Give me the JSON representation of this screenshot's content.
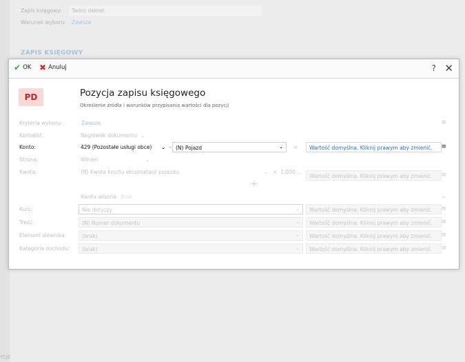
{
  "background": {
    "rows": [
      {
        "label": "Zapis księgowy:",
        "value": "Twórz dekret"
      },
      {
        "label": "Warunek wyboru:",
        "value": "Zawsze"
      }
    ],
    "section_title": "ZAPIS KSIĘGOWY",
    "bottom_text": "YCJE"
  },
  "dialog": {
    "toolbar": {
      "ok_label": "OK",
      "cancel_label": "Anuluj",
      "help_label": "?",
      "close_label": "✕"
    },
    "badge": "PD",
    "title": "Pozycja zapisu księgowego",
    "subtitle": "Określenie źródła i warunków przypisania wartości dla pozycji",
    "form": {
      "kryteria": {
        "label": "Kryteria wyboru:",
        "value": "Zawsze"
      },
      "kontekst": {
        "label": "Kontekst:",
        "value": "Nagłówek dokumentu"
      },
      "konto": {
        "label": "Konto:",
        "value": "429 (Pozostałe usługi obce)",
        "separator": "-",
        "value2": "(N) Pojazd",
        "default": "Wartość domyślna. Kliknij prawym aby zmienić."
      },
      "strona": {
        "label": "Strona:",
        "value": "Winien"
      },
      "kwota": {
        "label": "Kwota:",
        "value": "(N) Kwota kosztu eksploatacji pojazdu",
        "multiplier": "x",
        "factor": "1,000 ...",
        "default": "Wartość domyślna. Kliknij prawym aby zmienić."
      },
      "kwota_wlasna": {
        "label": "Kwota własna:",
        "value": "Brak"
      },
      "kurs": {
        "label": "Kurs:",
        "value": "Nie dotyczy",
        "default": "Wartość domyślna. Kliknij prawym aby zmienić."
      },
      "tresc": {
        "label": "Treść:",
        "value": "(N) Numer dokumentu",
        "default": "Wartość domyślna. Kliknij prawym aby zmienić."
      },
      "element": {
        "label": "Element słownika:",
        "value": "(brak)",
        "default": "Wartość domyślna. Kliknij prawym aby zmienić."
      },
      "kategoria": {
        "label": "Kategoria dochodu:",
        "value": "(brak)",
        "default": "Wartość domyślna. Kliknij prawym aby zmienić."
      }
    }
  },
  "icons": {
    "ok": "check-icon",
    "cancel": "x-icon",
    "menu": "hamburger-icon",
    "dropdown": "chevron-down-icon",
    "add": "plus-icon"
  },
  "colors": {
    "ok_green": "#3aa935",
    "cancel_red": "#d7302f",
    "badge_bg": "#f8d9d6",
    "badge_fg": "#c1272d",
    "link_blue": "#1f6fbf"
  }
}
